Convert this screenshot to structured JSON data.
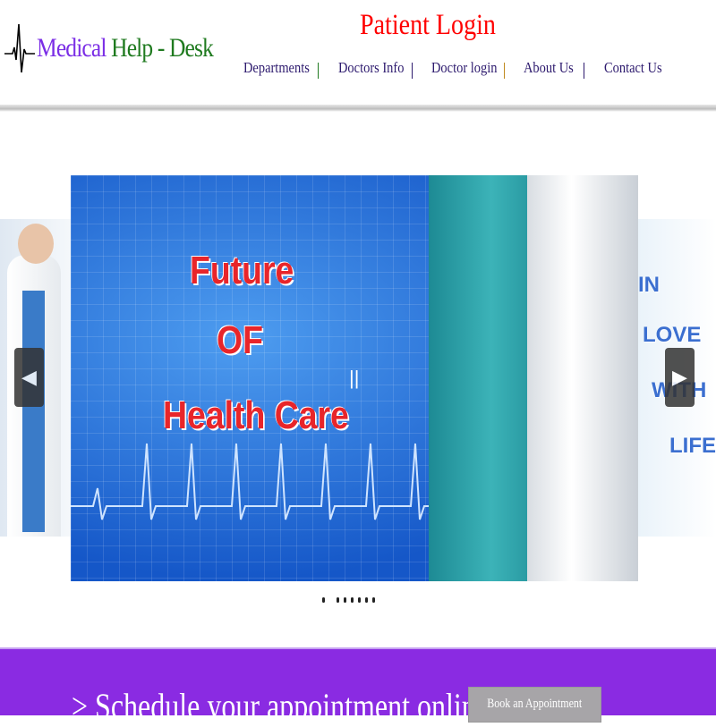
{
  "header": {
    "brand": {
      "part1": "Medical",
      "part2": "Help - Desk"
    },
    "patient_login": "Patient Login",
    "nav": [
      {
        "label": "Departments"
      },
      {
        "label": "Doctors Info"
      },
      {
        "label": "Doctor login"
      },
      {
        "label": "About Us"
      },
      {
        "label": "Contact Us"
      }
    ],
    "separator_colors": [
      "#1f7a1f",
      "#2d1a6e",
      "#1f7a1f",
      "#c08a20",
      "#2d1a6e"
    ]
  },
  "slider": {
    "main_text": [
      "Future",
      "OF",
      "Health Care"
    ],
    "right_text": [
      "IN",
      "LOVE",
      "WITH",
      "LIFE"
    ],
    "pause_label": "||",
    "prev_icon": "chevron-left-icon",
    "next_icon": "chevron-right-icon",
    "dot_count": 7
  },
  "cta": {
    "text": "> Schedule your appointment online",
    "button": "Book an Appointment",
    "background": "#8a2be2"
  }
}
